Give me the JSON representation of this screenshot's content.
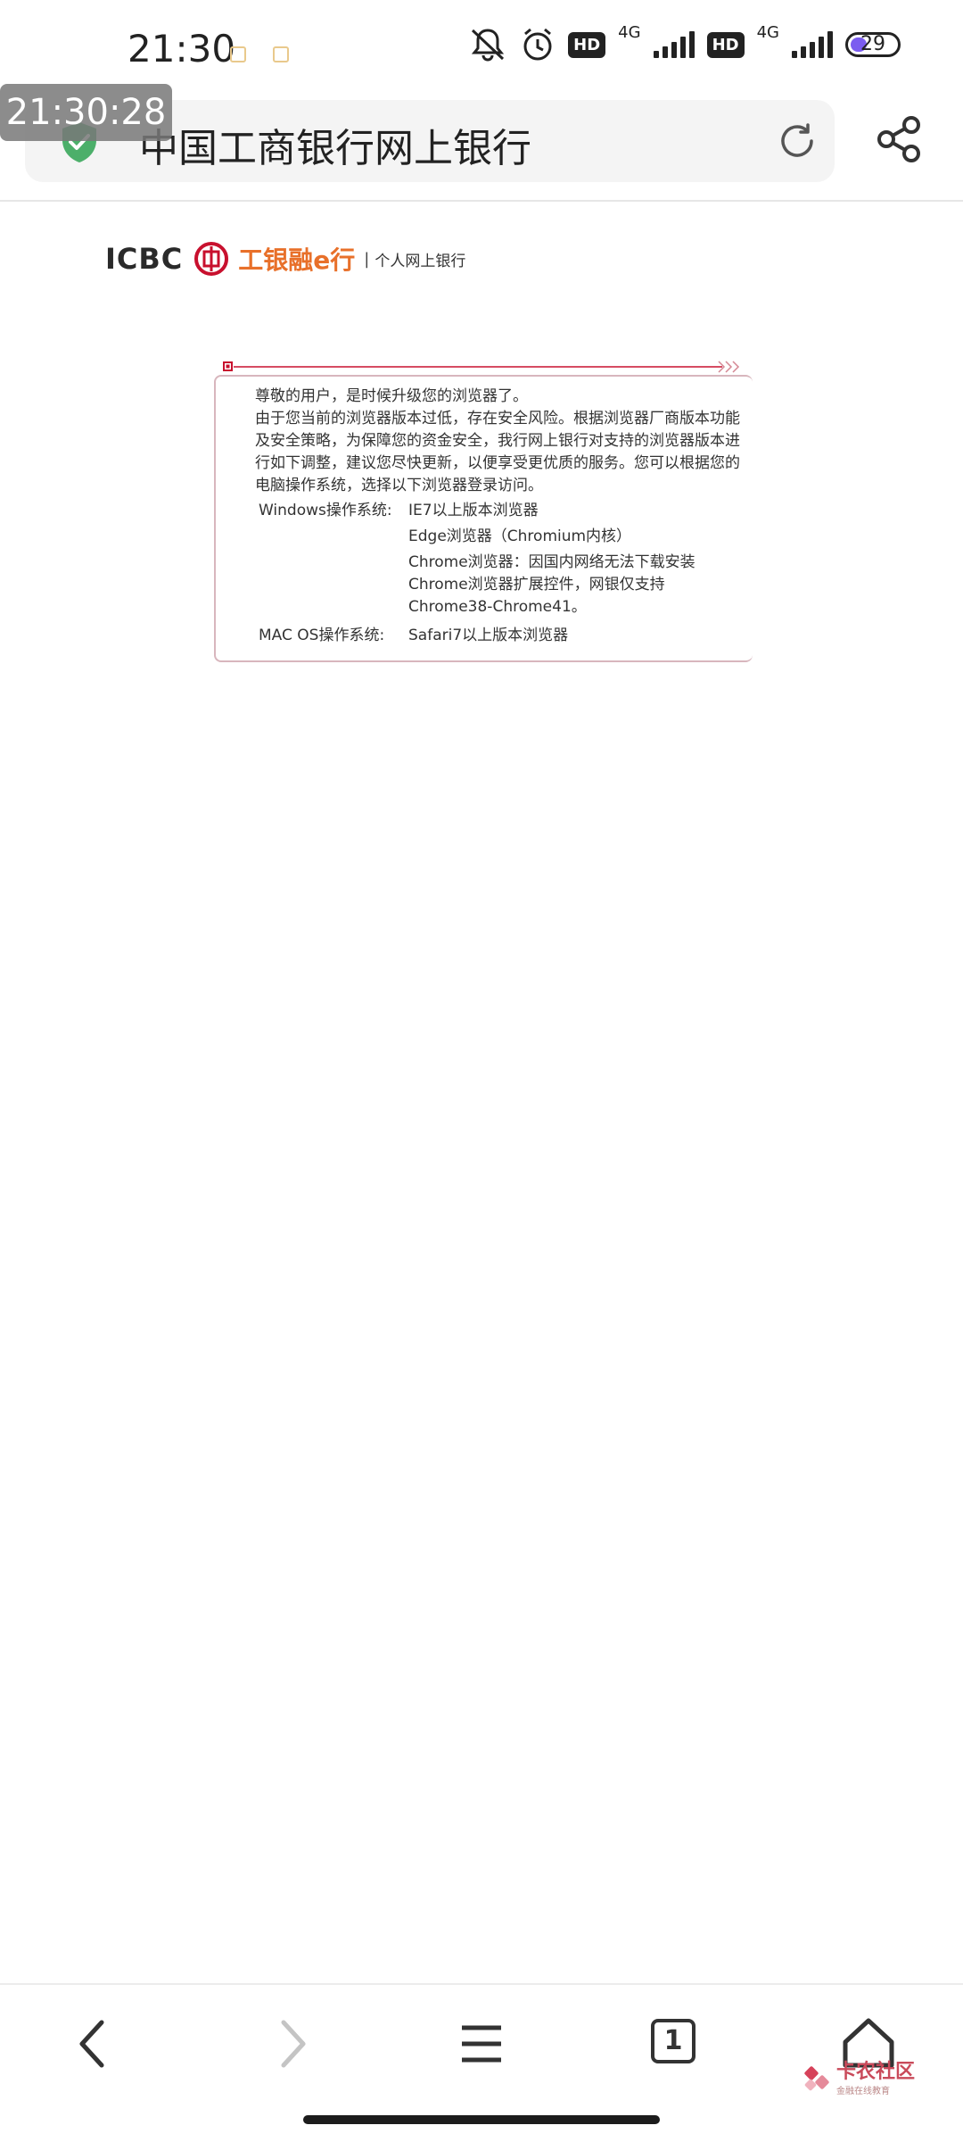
{
  "status_bar": {
    "time": "21:30",
    "network_1": "4G",
    "network_2": "4G",
    "hd_1": "HD",
    "hd_2": "HD",
    "battery": "29"
  },
  "timer_overlay": "21:30:28",
  "browser": {
    "page_title": "中国工商银行网上银行"
  },
  "icbc_header": {
    "logo_text": "ICBC",
    "brand": "工银融e行",
    "separator": "|",
    "subtitle": "个人网上银行"
  },
  "notice": {
    "greeting": "尊敬的用户，是时候升级您的浏览器了。",
    "body": "由于您当前的浏览器版本过低，存在安全风险。根据浏览器厂商版本功能及安全策略，为保障您的资金安全，我行网上银行对支持的浏览器版本进行如下调整，建议您尽快更新，以便享受更优质的服务。您可以根据您的电脑操作系统，选择以下浏览器登录访问。",
    "windows_label": "Windows操作系统:",
    "windows_items": [
      "IE7以上版本浏览器",
      "Edge浏览器（Chromium内核）",
      "Chrome浏览器：因国内网络无法下载安装Chrome浏览器扩展控件，网银仅支持Chrome38-Chrome41。"
    ],
    "mac_label": "MAC OS操作系统:",
    "mac_item": "Safari7以上版本浏览器"
  },
  "bottom_nav": {
    "tab_count": "1"
  },
  "watermark": {
    "title": "卡农社区",
    "subtitle": "金融在线教育"
  },
  "colors": {
    "accent_red": "#c8102e",
    "brand_orange": "#e8702a",
    "shield_green": "#4caf6a",
    "battery_purple": "#7b5cf0"
  }
}
